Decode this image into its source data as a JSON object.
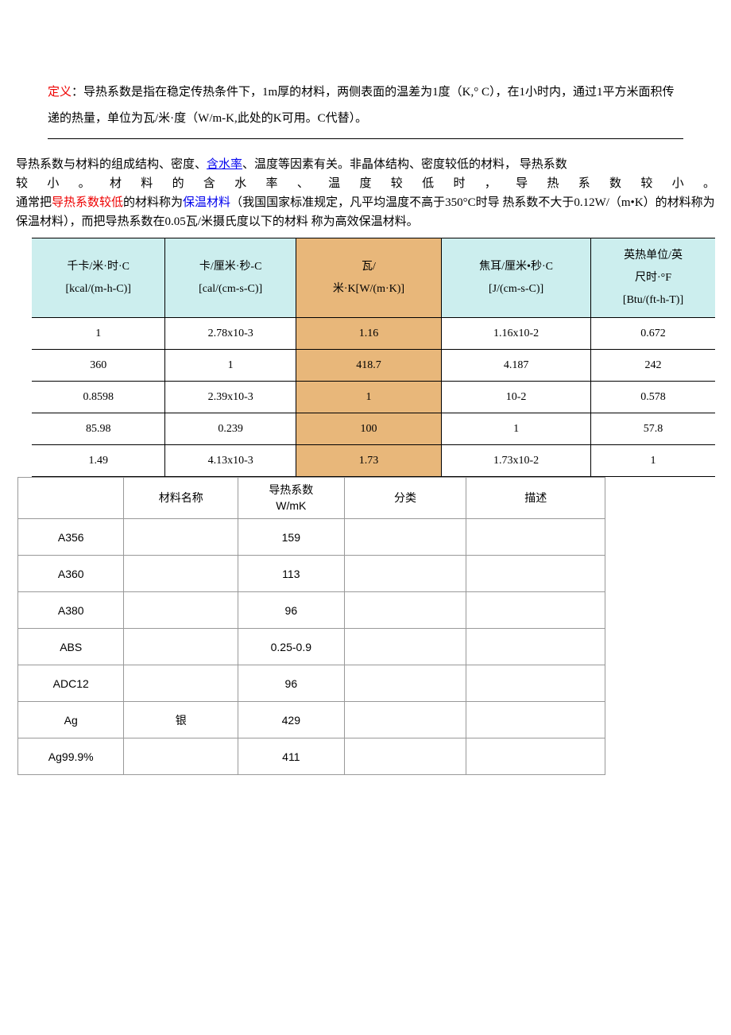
{
  "header": {
    "def_label": "定义",
    "def_text": "：导热系数是指在稳定传热条件下，1m厚的材料，两侧表面的温差为1度（K,° C），在1小时内，通过1平方米面积传递的热量，单位为瓦/米·度（W/m‐K,此处的K可用。C代替）。"
  },
  "para": {
    "p1_a": "导热系数与材料的组成结构、密度、",
    "p1_link": "含水率",
    "p1_b": "、温度等因素有关。非晶体结构、密度较低的材料， 导热系数",
    "p2": "较小。材料的含水率、温度较低时，导热系数较小。",
    "p3_a": "通常把",
    "p3_red": "导热系数较低",
    "p3_b": "的材料称为",
    "p3_blue": "保温材料",
    "p3_c": "（我国国家标准规定，凡平均温度不高于350°C时导 热系数不大于0.12W/（m•K）的材料称为保温材料），而把导热系数在0.05瓦/米摄氏度以下的材料 称为高效保温材料。"
  },
  "table1": {
    "headers": [
      "千卡/米·时·C\n[kcal/(m-h-C)]",
      "卡/厘米·秒-C\n[cal/(cm-s-C)]",
      "瓦/\n米·K[W/(m·K)]",
      "焦耳/厘米•秒·C\n[J/(cm-s-C)]",
      "英热单位/英\n尺时·°F\n[Btu/(ft-h-T)]"
    ],
    "rows": [
      [
        "1",
        "2.78x10-3",
        "1.16",
        "1.16x10-2",
        "0.672"
      ],
      [
        "360",
        "1",
        "418.7",
        "4.187",
        "242"
      ],
      [
        "0.8598",
        "2.39x10-3",
        "1",
        "10-2",
        "0.578"
      ],
      [
        "85.98",
        "0.239",
        "100",
        "1",
        "57.8"
      ],
      [
        "1.49",
        "4.13x10-3",
        "1.73",
        "1.73x10-2",
        "1"
      ]
    ]
  },
  "table2": {
    "headers": [
      "",
      "材料名称",
      "导热系数\nW/mK",
      "分类",
      "描述"
    ],
    "rows": [
      [
        "A356",
        "",
        "159",
        "",
        ""
      ],
      [
        "A360",
        "",
        "113",
        "",
        ""
      ],
      [
        "A380",
        "",
        "96",
        "",
        ""
      ],
      [
        "ABS",
        "",
        "0.25-0.9",
        "",
        ""
      ],
      [
        "ADC12",
        "",
        "96",
        "",
        ""
      ],
      [
        "Ag",
        "银",
        "429",
        "",
        ""
      ],
      [
        "Ag99.9%",
        "",
        "411",
        "",
        ""
      ]
    ]
  }
}
